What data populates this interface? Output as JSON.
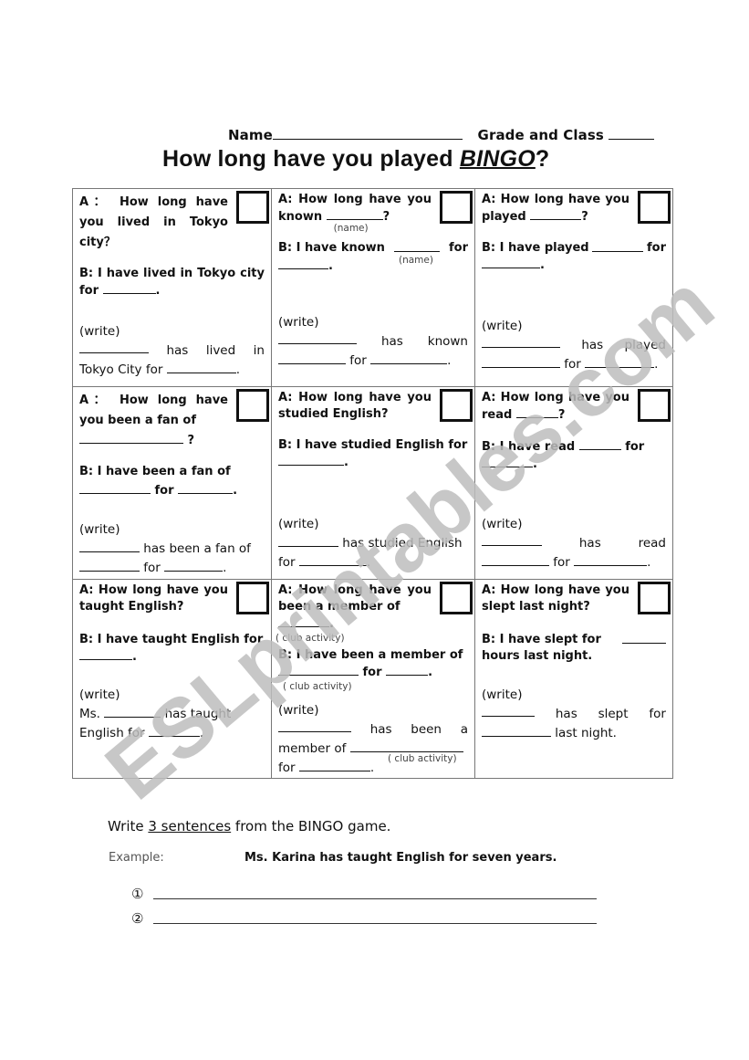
{
  "header": {
    "name_label": "Name",
    "grade_label": "Grade and Class"
  },
  "title": {
    "prefix": "How long have you played ",
    "emphasis": "BINGO",
    "suffix": "?"
  },
  "cells": [
    {
      "a": "A： How long have you lived in Tokyo city？",
      "b_text": "B: I have lived in Tokyo city for",
      "write_label": "(write)",
      "write_1": "has lived in",
      "write_2": "Tokyo City for"
    },
    {
      "a_text": "A: How long have you known",
      "a_hint": "(name)",
      "b_text": "B: I have known",
      "b_hint": "(name)",
      "b_for": "for",
      "write_label": "(write)",
      "write_1": "has known",
      "write_2": "for"
    },
    {
      "a_text": "A: How long have you played",
      "b_text": "B: I have played",
      "b_for": "for",
      "write_label": "(write)",
      "write_1": "has played",
      "write_2": "for"
    },
    {
      "a_text": "A： How long have you been a fan of",
      "b_text": "B: I have been a fan of",
      "b_for": "for",
      "write_label": "(write)",
      "write_1": "has been a fan of",
      "write_2": "for"
    },
    {
      "a_text": "A: How long have you studied English?",
      "b_text": "B: I have studied English for",
      "write_label": "(write)",
      "write_1": "has studied English",
      "write_2": "for"
    },
    {
      "a_text": "A: How long have you read",
      "b_text": "B: I have read",
      "b_for": "for",
      "write_label": "(write)",
      "write_1": "has read",
      "write_2": "for"
    },
    {
      "a_text": "A: How long have you taught English?",
      "b_text": "B: I have taught English for",
      "write_label": "(write)",
      "write_1_prefix": "Ms.",
      "write_1": "has taught",
      "write_2": "English for"
    },
    {
      "a_text": "A: How long have you been a member of",
      "a_hint": "( club activity)",
      "b_text": "B: I have been a member of",
      "b_for": "for",
      "b_hint": "( club activity)",
      "write_label": "(write)",
      "write_1": "has been a",
      "write_2": "member of",
      "write_hint": "( club activity)",
      "write_3": "for"
    },
    {
      "a_text": "A: How long have you slept last night?",
      "b_text": "B: I have slept for",
      "b_tail": "hours last night.",
      "write_label": "(write)",
      "write_1": "has slept for",
      "write_2": "last night."
    }
  ],
  "footer": {
    "instr_prefix": "Write ",
    "instr_underlined": "3 sentences",
    "instr_suffix": " from the BINGO game.",
    "example_label": "Example:",
    "example_text": "Ms. Karina has taught English for seven years.",
    "lines": [
      "①",
      "②"
    ]
  },
  "watermark": {
    "text": "ESLprintables.com",
    "color": "#bdbdbd"
  }
}
